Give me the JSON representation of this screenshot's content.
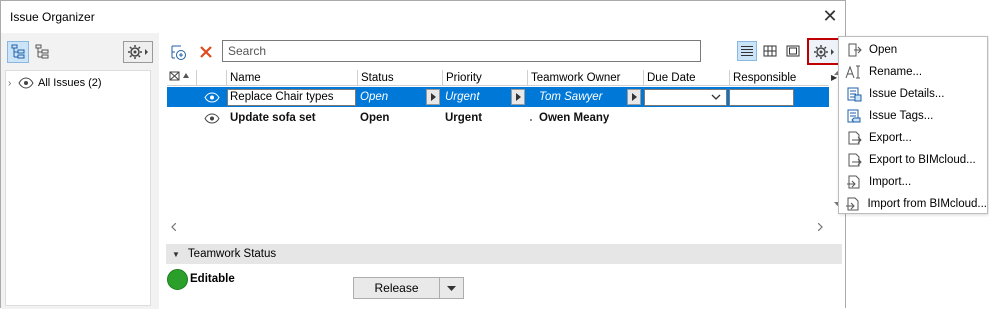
{
  "window": {
    "title": "Issue Organizer",
    "close_glyph": "✕"
  },
  "tree": {
    "root_label": "All Issues (2)"
  },
  "search": {
    "placeholder": "Search"
  },
  "table": {
    "columns": [
      "Name",
      "Status",
      "Priority",
      "Teamwork Owner",
      "Due Date",
      "Responsible"
    ],
    "rows": [
      {
        "name": "Replace Chair types",
        "status": "Open",
        "priority": "Urgent",
        "owner": "Tom Sawyer",
        "due": "",
        "responsible": ""
      },
      {
        "name": "Update sofa set",
        "status": "Open",
        "priority": "Urgent",
        "owner": "Owen Meany",
        "due": "",
        "responsible": ""
      }
    ]
  },
  "teamwork": {
    "section_title": "Teamwork Status",
    "status": "Editable",
    "release_label": "Release"
  },
  "menu": {
    "items": [
      {
        "label": "Open",
        "icon": "open-icon"
      },
      {
        "label": "Rename...",
        "icon": "rename-icon"
      },
      {
        "label": "Issue Details...",
        "icon": "issue-details-icon"
      },
      {
        "label": "Issue Tags...",
        "icon": "issue-tags-icon"
      },
      {
        "label": "Export...",
        "icon": "export-icon"
      },
      {
        "label": "Export to BIMcloud...",
        "icon": "export-bimcloud-icon"
      },
      {
        "label": "Import...",
        "icon": "import-icon"
      },
      {
        "label": "Import from BIMcloud...",
        "icon": "import-bimcloud-icon"
      }
    ]
  },
  "colors": {
    "selection": "#0078d7",
    "highlight_border": "#c00000",
    "status_green": "#2aa02a"
  }
}
